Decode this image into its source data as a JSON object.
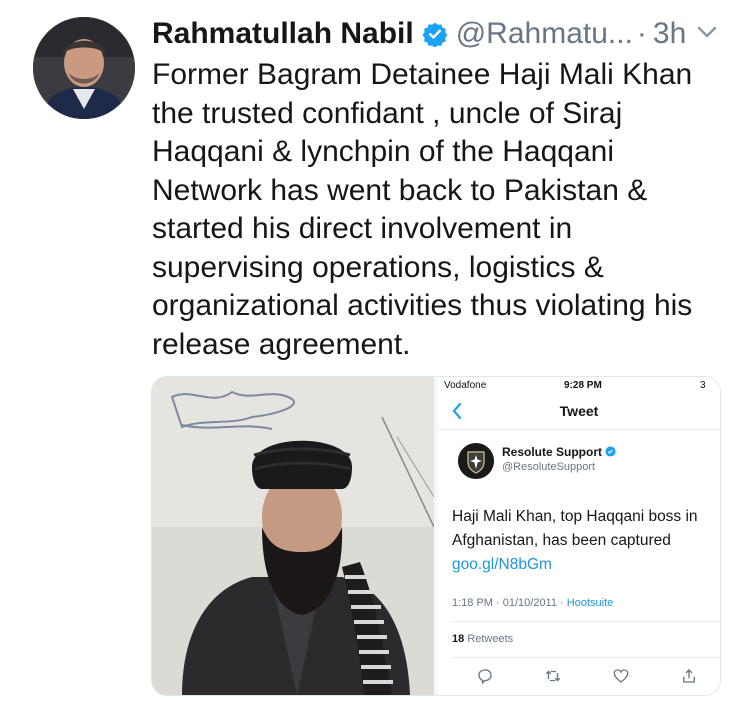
{
  "tweet": {
    "author_name": "Rahmatullah Nabil",
    "author_handle": "@Rahmatu...",
    "separator": "·",
    "time": "3h",
    "text_lines": [
      "Former Bagram Detainee Haji Mali Khan",
      "the trusted confidant , uncle of Siraj",
      "Haqqani & lynchpin of the Haqqani",
      "Network has went back to Pakistan &",
      "started his direct involvement in",
      "supervising operations, logistics &",
      "organizational activities thus violating his",
      "release agreement."
    ]
  },
  "screenshot": {
    "carrier": "Vodafone",
    "clock": "9:28 PM",
    "battery": "3",
    "nav_title": "Tweet",
    "account_name": "Resolute Support",
    "account_handle": "@ResoluteSupport",
    "text_line_1": "Haji Mali Khan, top Haqqani boss in",
    "text_line_2": "Afghanistan, has been captured",
    "link": "goo.gl/N8bGm",
    "timestamp": "1:18 PM · 01/10/2011 · ",
    "via_app": "Hootsuite",
    "retweet_count": "18",
    "retweet_label": "Retweets"
  },
  "colors": {
    "verified": "#1da1f2",
    "link": "#1b95e0",
    "muted": "#657786"
  },
  "icons": [
    "verified-badge-icon",
    "chevron-down-icon",
    "back-arrow-icon",
    "reply-icon",
    "retweet-icon",
    "like-icon",
    "share-icon"
  ]
}
